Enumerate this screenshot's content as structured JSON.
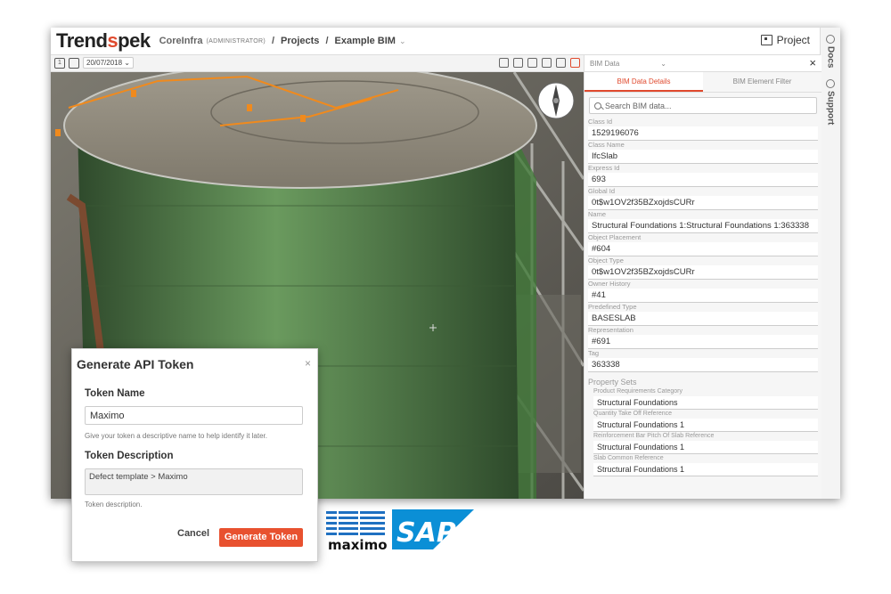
{
  "header": {
    "logo": {
      "main": "Trend",
      "accent": "s",
      "rest": "pek"
    },
    "breadcrumb": {
      "org": "CoreInfra",
      "role": "(ADMINISTRATOR)",
      "sep1": "/",
      "projects": "Projects",
      "sep2": "/",
      "current": "Example BIM",
      "chevron": "⌄"
    },
    "project_button": "Project"
  },
  "rail": {
    "docs": "Docs",
    "support": "Support"
  },
  "toolbar": {
    "date": "20/07/2018",
    "date_chevron": "⌄",
    "layer_number": "1"
  },
  "bim_panel": {
    "selector": "BIM Data",
    "selector_chevron": "⌄",
    "close": "×",
    "tabs": [
      "BIM Data Details",
      "BIM Element Filter"
    ],
    "search_placeholder": "Search BIM data...",
    "fields": [
      {
        "label": "Class Id",
        "value": "1529196076"
      },
      {
        "label": "Class Name",
        "value": "IfcSlab"
      },
      {
        "label": "Express Id",
        "value": "693"
      },
      {
        "label": "Global Id",
        "value": "0t$w1OV2f35BZxojdsCURr"
      },
      {
        "label": "Name",
        "value": "Structural Foundations 1:Structural Foundations 1:363338"
      },
      {
        "label": "Object Placement",
        "value": "#604"
      },
      {
        "label": "Object Type",
        "value": "0t$w1OV2f35BZxojdsCURr"
      },
      {
        "label": "Owner History",
        "value": "#41"
      },
      {
        "label": "Predefined Type",
        "value": "BASESLAB"
      },
      {
        "label": "Representation",
        "value": "#691"
      },
      {
        "label": "Tag",
        "value": "363338"
      }
    ],
    "property_sets_title": "Property Sets",
    "property_sets": [
      {
        "label": "Product Requirements Category",
        "value": "Structural Foundations"
      },
      {
        "label": "Quantity Take Off Reference",
        "value": "Structural Foundations 1"
      },
      {
        "label": "Reinforcement Bar Pitch Of Slab Reference",
        "value": "Structural Foundations 1"
      },
      {
        "label": "Slab Common Reference",
        "value": "Structural Foundations 1"
      }
    ]
  },
  "dialog": {
    "title": "Generate API Token",
    "close": "×",
    "token_name_label": "Token Name",
    "token_name_value": "Maximo",
    "token_name_help": "Give your token a descriptive name to help identify it later.",
    "token_desc_label": "Token Description",
    "token_desc_value": "Defect template > Maximo",
    "token_desc_help": "Token description.",
    "cancel_label": "Cancel",
    "generate_label": "Generate Token"
  },
  "logos": {
    "ibm": "IBM",
    "maximo": "maximo",
    "sap": "SAP"
  },
  "colors": {
    "accent": "#e8512f",
    "ibm_blue": "#1f70c1",
    "sap_blue": "#0b8fd6",
    "overlay_green": "#3f9a3a"
  }
}
